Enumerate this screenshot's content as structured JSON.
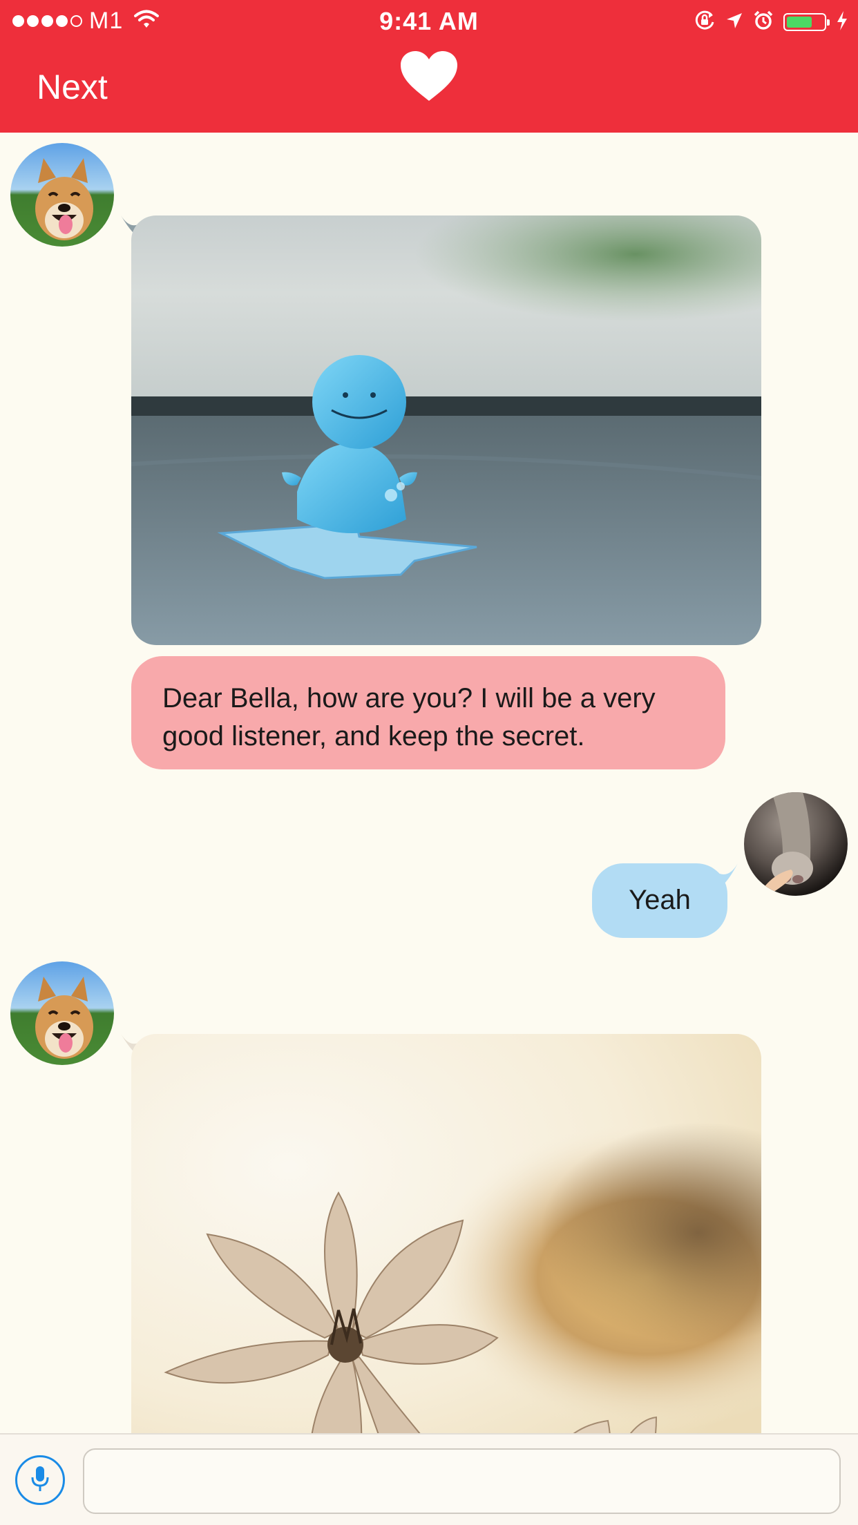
{
  "status_bar": {
    "carrier": "M1",
    "time": "9:41 AM",
    "signal_bars_filled": 4,
    "signal_bars_total": 5,
    "battery_level": 0.7,
    "icons": [
      "wifi-icon",
      "orientation-lock-icon",
      "location-arrow-icon",
      "alarm-icon",
      "battery-icon",
      "charging-bolt-icon"
    ]
  },
  "nav": {
    "left_label": "Next",
    "center_icon": "heart-icon"
  },
  "messages": [
    {
      "sender": "other",
      "type": "image",
      "avatar": "dog-avatar",
      "image": "blue-figurine-on-dashboard-photo"
    },
    {
      "sender": "other",
      "type": "text",
      "text": "Dear Bella, how are you? I will be a very good listener, and keep the secret."
    },
    {
      "sender": "me",
      "type": "text",
      "avatar": "cat-paw-avatar",
      "text": "Yeah"
    },
    {
      "sender": "other",
      "type": "image",
      "avatar": "dog-avatar",
      "image": "cosmos-flowers-sunlight-photo"
    }
  ],
  "input_bar": {
    "mic_icon": "microphone-icon",
    "placeholder": "",
    "value": ""
  },
  "colors": {
    "accent": "#ee2f3b",
    "background": "#fdfbf1",
    "incoming_bubble": "#f8a9ab",
    "outgoing_bubble": "#b2dcf4",
    "mic_blue": "#1a8be6",
    "battery_green": "#4cd964"
  }
}
